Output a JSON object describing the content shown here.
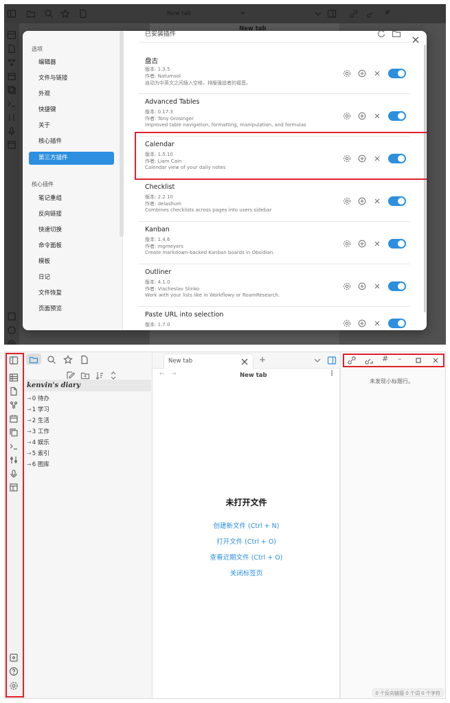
{
  "top_screenshot": {
    "app_tab_title": "New tab",
    "main_header": "New tab",
    "settings": {
      "partial_heading": "已安装插件",
      "nav_section_options": "选项",
      "nav_options": [
        "编辑器",
        "文件与链接",
        "外观",
        "快捷键",
        "关于",
        "核心插件",
        "第三方插件"
      ],
      "active_item": "第三方插件",
      "nav_section_core": "核心插件",
      "nav_core": [
        "笔记重组",
        "反向链接",
        "快速切换",
        "命令面板",
        "模板",
        "日记",
        "文件恢复",
        "页面预览"
      ],
      "plugins": [
        {
          "name": "盘古",
          "version": "版本: 1.3.5",
          "author": "作者: Natumsol",
          "desc": "自动为中英文之间插入空格，排版强迫者的福音。",
          "enabled": true
        },
        {
          "name": "Advanced Tables",
          "version": "版本: 0.17.3",
          "author": "作者: Tony Grosinger",
          "desc": "Improved table navigation, formatting, manipulation, and formulas",
          "enabled": true
        },
        {
          "name": "Calendar",
          "version": "版本: 1.5.10",
          "author": "作者: Liam Cain",
          "desc": "Calendar view of your daily notes",
          "enabled": true
        },
        {
          "name": "Checklist",
          "version": "版本: 2.2.10",
          "author": "作者: delashum",
          "desc": "Combines checklists across pages into users sidebar",
          "enabled": true
        },
        {
          "name": "Kanban",
          "version": "版本: 1.4.6",
          "author": "作者: mgmeyers",
          "desc": "Create markdown-backed Kanban boards in Obsidian.",
          "enabled": true
        },
        {
          "name": "Outliner",
          "version": "版本: 4.1.0",
          "author": "作者: Viacheslav Slinko",
          "desc": "Work with your lists like in Workflowy or RoamResearch.",
          "enabled": true
        },
        {
          "name": "Paste URL into selection",
          "version": "版本: 1.7.0",
          "author": "",
          "desc": "",
          "enabled": true
        }
      ],
      "highlight_color": "#e0202a",
      "accent_color": "#2c8fe0"
    }
  },
  "bottom_screenshot": {
    "tab_title": "New tab",
    "header_title": "New tab",
    "vault_name": "kenvin's diary",
    "folders": [
      "0 待办",
      "1 学习",
      "2 生活",
      "3 工作",
      "4 娱乐",
      "5 索引",
      "6 图库"
    ],
    "empty_title": "未打开文件",
    "actions": [
      "创建新文件 (Ctrl + N)",
      "打开文件 (Ctrl + O)",
      "查看近期文件 (Ctrl + O)",
      "关闭标签页"
    ],
    "outline_empty": "未发现小标题行。",
    "status_bar": "0 个反向链接  0 个词  0 个字符",
    "highlight_color": "#e0202a",
    "accent_color": "#2c8fe0"
  }
}
